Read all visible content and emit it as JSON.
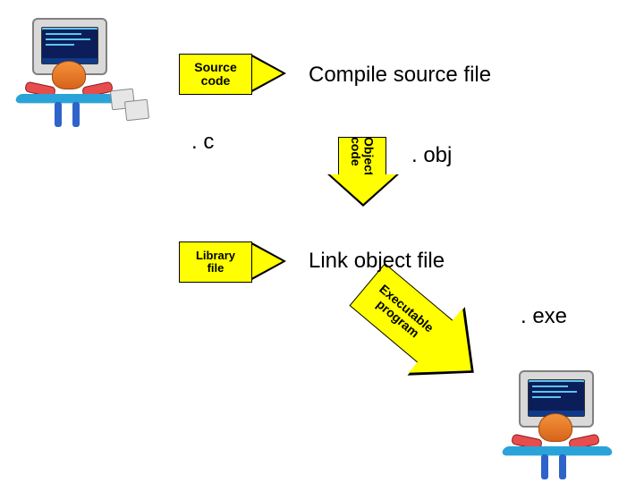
{
  "boxes": {
    "source_code": "Source\ncode",
    "object_code": "Object\ncode",
    "library_file": "Library\nfile",
    "executable_program": "Executable\nprogram"
  },
  "labels": {
    "compile": "Compile source file",
    "link": "Link object file",
    "ext_c": ". c",
    "ext_obj": ". obj",
    "ext_exe": ". exe"
  },
  "icons": {
    "programmer": "user-at-computer-icon"
  },
  "colors": {
    "arrow_fill": "#ffff00",
    "arrow_stroke": "#000000"
  }
}
